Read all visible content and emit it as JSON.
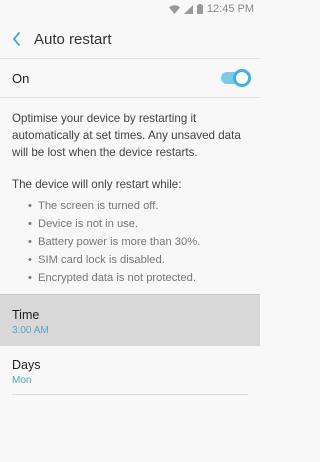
{
  "status_bar": {
    "time": "12:45 PM"
  },
  "header": {
    "title": "Auto restart"
  },
  "toggle": {
    "label": "On",
    "state": true,
    "accent_color": "#43b1dc"
  },
  "description": "Optimise your device by restarting it automatically at set times. Any unsaved data will be lost when the device restarts.",
  "conditions": {
    "heading": "The device will only restart while:",
    "items": [
      "The screen is turned off.",
      "Device is not in use.",
      "Battery power is more than 30%.",
      "SIM card lock is disabled.",
      "Encrypted data is not protected."
    ]
  },
  "settings": {
    "time": {
      "label": "Time",
      "value": "3:00 AM"
    },
    "days": {
      "label": "Days",
      "value": "Mon"
    }
  }
}
